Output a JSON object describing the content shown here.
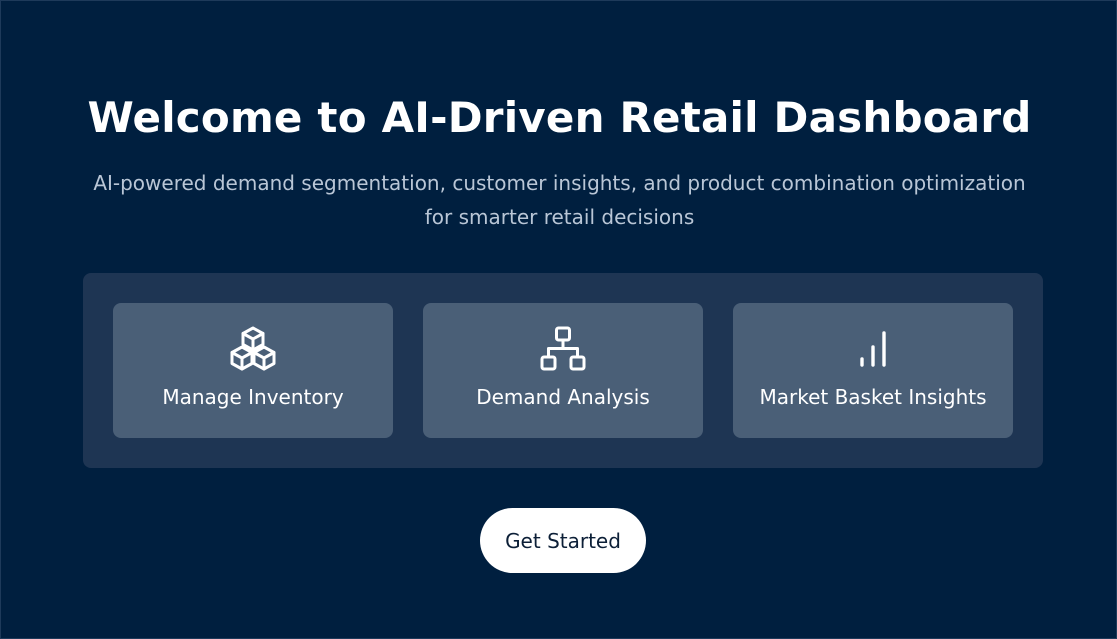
{
  "hero": {
    "title": "Welcome to AI-Driven Retail Dashboard",
    "subtitle": "AI-powered demand segmentation, customer insights, and product combination optimization for smarter retail decisions"
  },
  "features": [
    {
      "label": "Manage Inventory",
      "icon": "cubes-icon"
    },
    {
      "label": "Demand Analysis",
      "icon": "sitemap-icon"
    },
    {
      "label": "Market Basket Insights",
      "icon": "bar-chart-icon"
    }
  ],
  "cta": {
    "label": "Get Started"
  },
  "colors": {
    "background": "#001f3f",
    "panel": "#1e3553",
    "card": "#4a5f77",
    "subtitle": "#b9c6d6",
    "button_bg": "#ffffff",
    "button_text": "#0c1f37"
  }
}
